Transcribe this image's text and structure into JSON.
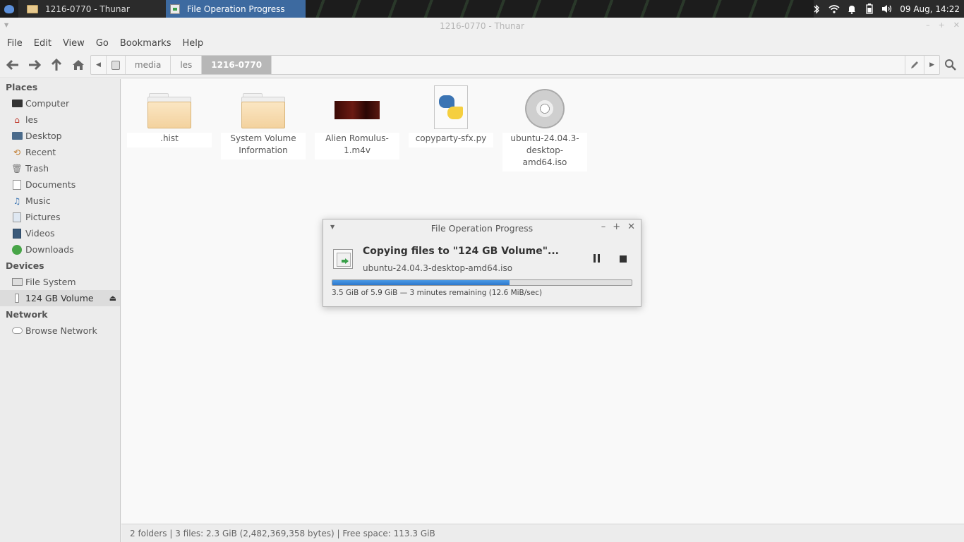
{
  "taskbar": {
    "items": [
      {
        "label": "1216-0770 - Thunar",
        "icon": "folder-icon",
        "active": false
      },
      {
        "label": "File Operation Progress",
        "icon": "file-progress-icon",
        "active": true
      }
    ],
    "tray_icons": [
      "bluetooth-icon",
      "wifi-icon",
      "notification-bell-icon",
      "battery-icon",
      "volume-icon"
    ],
    "clock": "09 Aug, 14:22"
  },
  "window": {
    "title": "1216-0770 - Thunar"
  },
  "menu": [
    "File",
    "Edit",
    "View",
    "Go",
    "Bookmarks",
    "Help"
  ],
  "pathbar": {
    "segments": [
      "media",
      "les",
      "1216-0770"
    ],
    "active": "1216-0770"
  },
  "sidebar": {
    "places_heading": "Places",
    "places": [
      {
        "label": "Computer",
        "icon": "computer-icon"
      },
      {
        "label": "les",
        "icon": "home-icon"
      },
      {
        "label": "Desktop",
        "icon": "desktop-icon"
      },
      {
        "label": "Recent",
        "icon": "recent-icon"
      },
      {
        "label": "Trash",
        "icon": "trash-icon"
      },
      {
        "label": "Documents",
        "icon": "documents-icon"
      },
      {
        "label": "Music",
        "icon": "music-icon"
      },
      {
        "label": "Pictures",
        "icon": "pictures-icon"
      },
      {
        "label": "Videos",
        "icon": "videos-icon"
      },
      {
        "label": "Downloads",
        "icon": "downloads-icon"
      }
    ],
    "devices_heading": "Devices",
    "devices": [
      {
        "label": "File System",
        "icon": "harddisk-icon"
      },
      {
        "label": "124 GB Volume",
        "icon": "usb-drive-icon",
        "selected": true
      }
    ],
    "network_heading": "Network",
    "network": [
      {
        "label": "Browse Network",
        "icon": "network-icon"
      }
    ]
  },
  "files": [
    {
      "name": ".hist",
      "type": "folder"
    },
    {
      "name": "System Volume Information",
      "type": "folder"
    },
    {
      "name": "Alien Romulus-1.m4v",
      "type": "video"
    },
    {
      "name": "copyparty-sfx.py",
      "type": "python"
    },
    {
      "name": "ubuntu-24.04.3-desktop-amd64.iso",
      "type": "disc-image"
    }
  ],
  "statusbar": "2 folders  |  3 files: 2.3 GiB (2,482,369,358 bytes)  |  Free space: 113.3 GiB",
  "dialog": {
    "title": "File Operation Progress",
    "heading": "Copying files to \"124 GB Volume\"...",
    "filename": "ubuntu-24.04.3-desktop-amd64.iso",
    "progress_fraction": 0.593,
    "status": "3.5 GiB of 5.9 GiB — 3 minutes remaining (12.6 MiB/sec)"
  }
}
